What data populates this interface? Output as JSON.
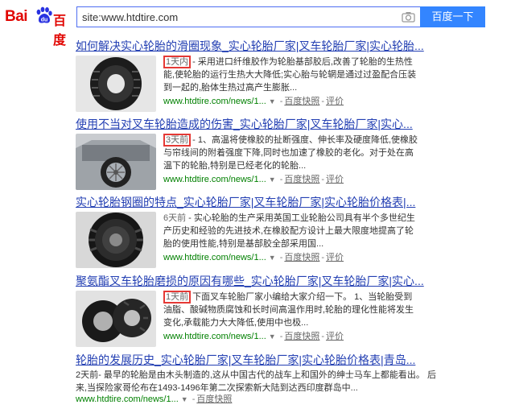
{
  "header": {
    "logo_text_left": "Bai",
    "logo_text_right": "百度",
    "search_value": "site:www.htdtire.com",
    "search_button": "百度一下"
  },
  "results": [
    {
      "title": "如何解决实心轮胎的滑圈现象_实心轮胎厂家|叉车轮胎厂家|实心轮胎...",
      "date": "1天内",
      "desc": "采用进口纤维胶作为轮胎基部胶后,改善了轮胎的生热性能,使轮胎的运行生热大大降低;实心胎与轮辋是通过过盈配合压装到一起的,胎体生热过高产生膨胀...",
      "url": "www.htdtire.com/news/1...",
      "snapshot": "百度快照",
      "rate": "评价"
    },
    {
      "title": "使用不当对叉车轮胎造成的伤害_实心轮胎厂家|叉车轮胎厂家|实心...",
      "date": "3天前",
      "desc": "1、高温将使橡胶的扯断强度、伸长率及硬度降低,使橡胶与帘线间的附着强度下降,同时也加速了橡胶的老化。对于处在高温下的轮胎,特别是已经老化的轮胎...",
      "url": "www.htdtire.com/news/1...",
      "snapshot": "百度快照",
      "rate": "评价"
    },
    {
      "title": "实心轮胎钢圈的特点_实心轮胎厂家|叉车轮胎厂家|实心轮胎价格表|...",
      "date": "6天前",
      "desc": "实心轮胎的生产采用英国工业轮胎公司具有半个多世纪生产历史和经验的先进技术,在橡胶配方设计上最大限度地提高了轮胎的使用性能,特别是基部胶全部采用国...",
      "url": "www.htdtire.com/news/1...",
      "snapshot": "百度快照",
      "rate": "评价"
    },
    {
      "title": "聚氨酯叉车轮胎磨损的原因有哪些_实心轮胎厂家|叉车轮胎厂家|实心...",
      "date": "1天前",
      "desc": "下面叉车轮胎厂家小编给大家介绍一下。 1、当轮胎受到油脂、酸碱物质腐蚀和长时间高温作用时,轮胎的理化性能将发生变化,承载能力大大降低,使用中也极...",
      "url": "www.htdtire.com/news/1...",
      "snapshot": "百度快照",
      "rate": "评价"
    },
    {
      "title": "轮胎的发展历史_实心轮胎厂家|叉车轮胎厂家|实心轮胎价格表|青岛...",
      "date": "2天前",
      "desc": "最早的轮胎是由木头制造的,这从中国古代的战车上和国外的绅士马车上都能看出。 后来,当探险家哥伦布在1493-1496年第二次探索新大陆到达西印度群岛中...",
      "url": "www.htdtire.com/news/1...",
      "snapshot": "百度快照",
      "rate": ""
    }
  ]
}
